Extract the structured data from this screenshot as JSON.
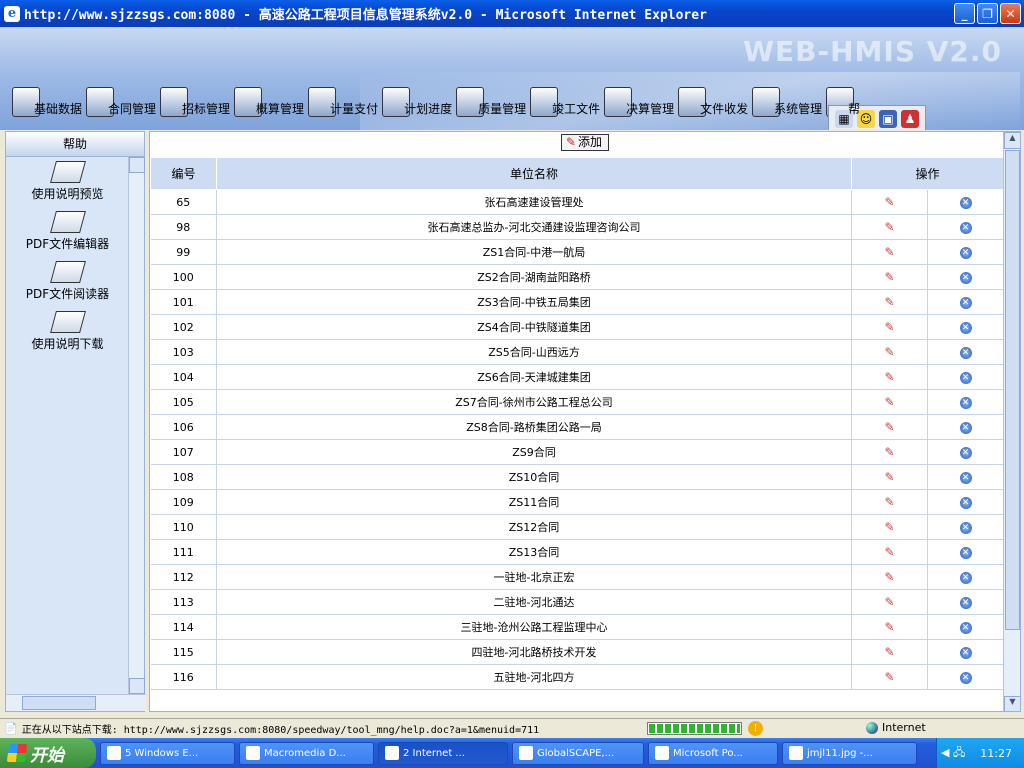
{
  "window": {
    "title": "http://www.sjzzsgs.com:8080 - 高速公路工程项目信息管理系统v2.0 - Microsoft Internet Explorer"
  },
  "banner": {
    "watermark": "WEB-HMIS V2.0",
    "menu": [
      {
        "label": "基础数据",
        "icon": "database-icon"
      },
      {
        "label": "合同管理",
        "icon": "contract-icon"
      },
      {
        "label": "招标管理",
        "icon": "bidding-icon"
      },
      {
        "label": "概算管理",
        "icon": "pie-chart-icon"
      },
      {
        "label": "计量支付",
        "icon": "payment-icon"
      },
      {
        "label": "计划进度",
        "icon": "bar-chart-icon"
      },
      {
        "label": "质量管理",
        "icon": "gears-icon"
      },
      {
        "label": "竣工文件",
        "icon": "documents-icon"
      },
      {
        "label": "决算管理",
        "icon": "calculator-icon"
      },
      {
        "label": "文件收发",
        "icon": "mail-icon"
      },
      {
        "label": "系统管理",
        "icon": "computer-icon"
      },
      {
        "label": "帮",
        "icon": "help-icon"
      }
    ]
  },
  "sidebar": {
    "header": "帮助",
    "items": [
      {
        "label": "使用说明预览"
      },
      {
        "label": "PDF文件编辑器"
      },
      {
        "label": "PDF文件阅读器"
      },
      {
        "label": "使用说明下载"
      }
    ]
  },
  "main": {
    "add_label": "添加",
    "columns": {
      "no": "编号",
      "name": "单位名称",
      "op": "操作"
    },
    "rows": [
      {
        "no": "65",
        "name": "张石高速建设管理处"
      },
      {
        "no": "98",
        "name": "张石高速总监办-河北交通建设监理咨询公司"
      },
      {
        "no": "99",
        "name": "ZS1合同-中港一航局"
      },
      {
        "no": "100",
        "name": "ZS2合同-湖南益阳路桥"
      },
      {
        "no": "101",
        "name": "ZS3合同-中铁五局集团"
      },
      {
        "no": "102",
        "name": "ZS4合同-中铁隧道集团"
      },
      {
        "no": "103",
        "name": "ZS5合同-山西远方"
      },
      {
        "no": "104",
        "name": "ZS6合同-天津城建集团"
      },
      {
        "no": "105",
        "name": "ZS7合同-徐州市公路工程总公司"
      },
      {
        "no": "106",
        "name": "ZS8合同-路桥集团公路一局"
      },
      {
        "no": "107",
        "name": "ZS9合同"
      },
      {
        "no": "108",
        "name": "ZS10合同"
      },
      {
        "no": "109",
        "name": "ZS11合同"
      },
      {
        "no": "110",
        "name": "ZS12合同"
      },
      {
        "no": "111",
        "name": "ZS13合同"
      },
      {
        "no": "112",
        "name": "一驻地-北京正宏"
      },
      {
        "no": "113",
        "name": "二驻地-河北通达"
      },
      {
        "no": "114",
        "name": "三驻地-沧州公路工程监理中心"
      },
      {
        "no": "115",
        "name": "四驻地-河北路桥技术开发"
      },
      {
        "no": "116",
        "name": "五驻地-河北四方"
      }
    ]
  },
  "status": {
    "text": "正在从以下站点下载: http://www.sjzzsgs.com:8080/speedway/tool_mng/help.doc?a=1&menuid=711",
    "zone": "Internet"
  },
  "taskbar": {
    "start": "开始",
    "buttons": [
      {
        "label": "5 Windows E..."
      },
      {
        "label": "Macromedia D..."
      },
      {
        "label": "2 Internet ..."
      },
      {
        "label": "GlobalSCAPE,..."
      },
      {
        "label": "Microsoft Po..."
      },
      {
        "label": "jmjl11.jpg -..."
      }
    ],
    "clock": "11:27"
  }
}
